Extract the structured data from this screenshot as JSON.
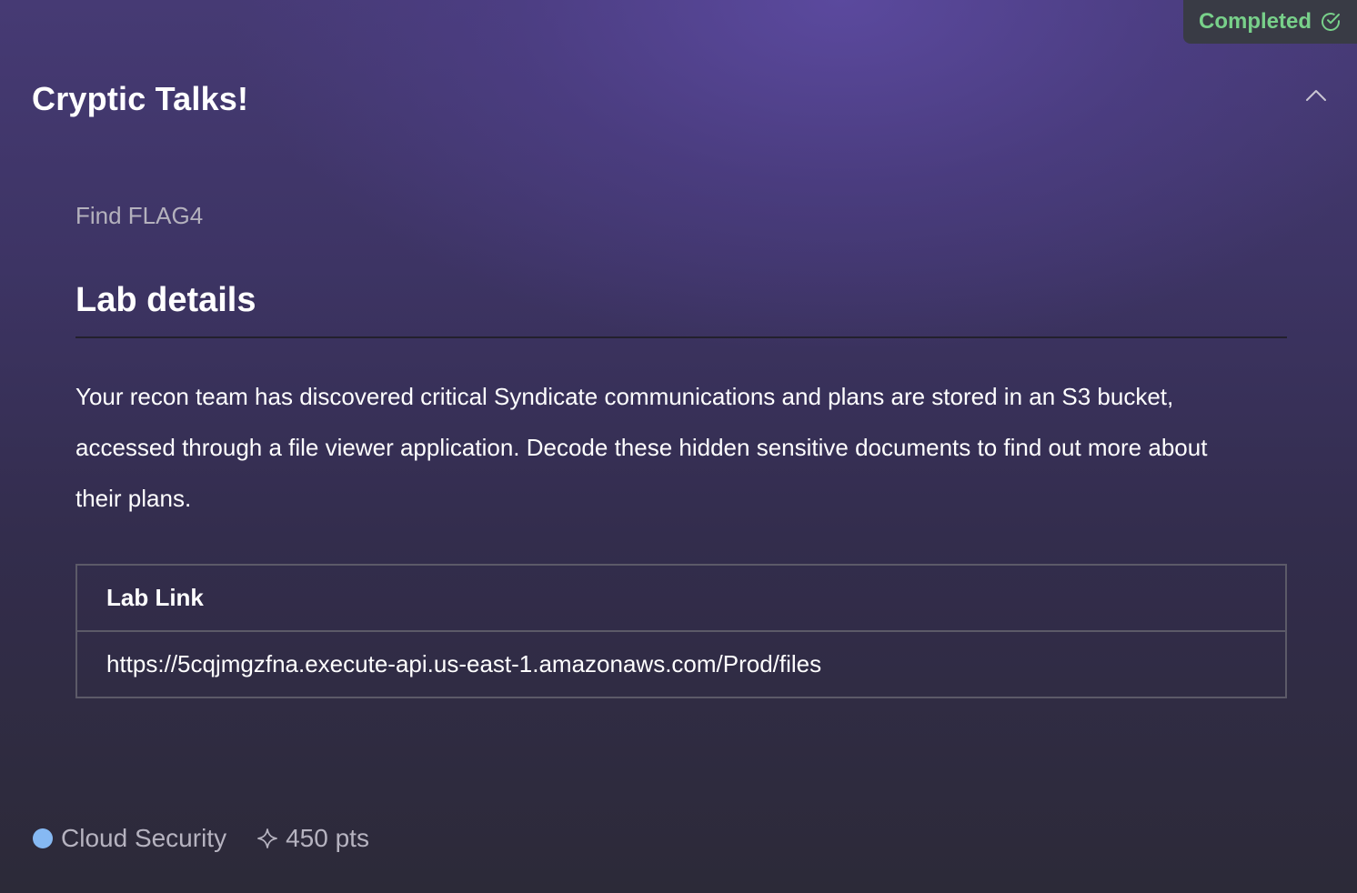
{
  "challenge": {
    "title": "Cryptic Talks!",
    "status": "Completed",
    "subtitle": "Find FLAG4",
    "section_heading": "Lab details",
    "description": "Your recon team has discovered critical Syndicate communications and plans are stored in an S3 bucket, accessed through a file viewer application. Decode these hidden sensitive documents to find out more about their plans.",
    "table": {
      "header": "Lab Link",
      "link": "https://5cqjmgzfna.execute-api.us-east-1.amazonaws.com/Prod/files"
    },
    "category": "Cloud Security",
    "points": "450 pts"
  },
  "colors": {
    "status_green": "#78d08a",
    "category_dot": "#86b9f3"
  },
  "icons": {
    "status": "check-circle-icon",
    "collapse": "chevron-up-icon",
    "points": "sparkle-icon"
  }
}
